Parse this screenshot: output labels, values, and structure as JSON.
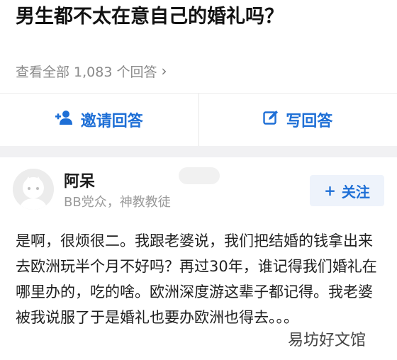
{
  "question": {
    "title": "男生都不太在意自己的婚礼吗？"
  },
  "view_all": {
    "label": "查看全部 1,083 个回答",
    "chevron": "›"
  },
  "actions": [
    {
      "label": "邀请回答",
      "icon": "invite-person-icon"
    },
    {
      "label": "写回答",
      "icon": "edit-icon"
    }
  ],
  "author": {
    "name": "阿呆",
    "bio": "BB党众，神教教徒",
    "follow_label": "关注",
    "follow_icon": "+"
  },
  "answer": {
    "text": "是啊，很烦很二。我跟老婆说，我们把结婚的钱拿出来去欧洲玩半个月不好吗？再过30年，谁记得我们婚礼在哪里办的，吃的啥。欧洲深度游这辈子都记得。我老婆被我说服了于是婚礼也要办欧洲也得去。。。"
  },
  "watermark": {
    "text": "易坊好文馆"
  },
  "colors": {
    "accent": "#1e6fd6",
    "muted": "#8a8a8a",
    "band": "#f1f1f3"
  }
}
